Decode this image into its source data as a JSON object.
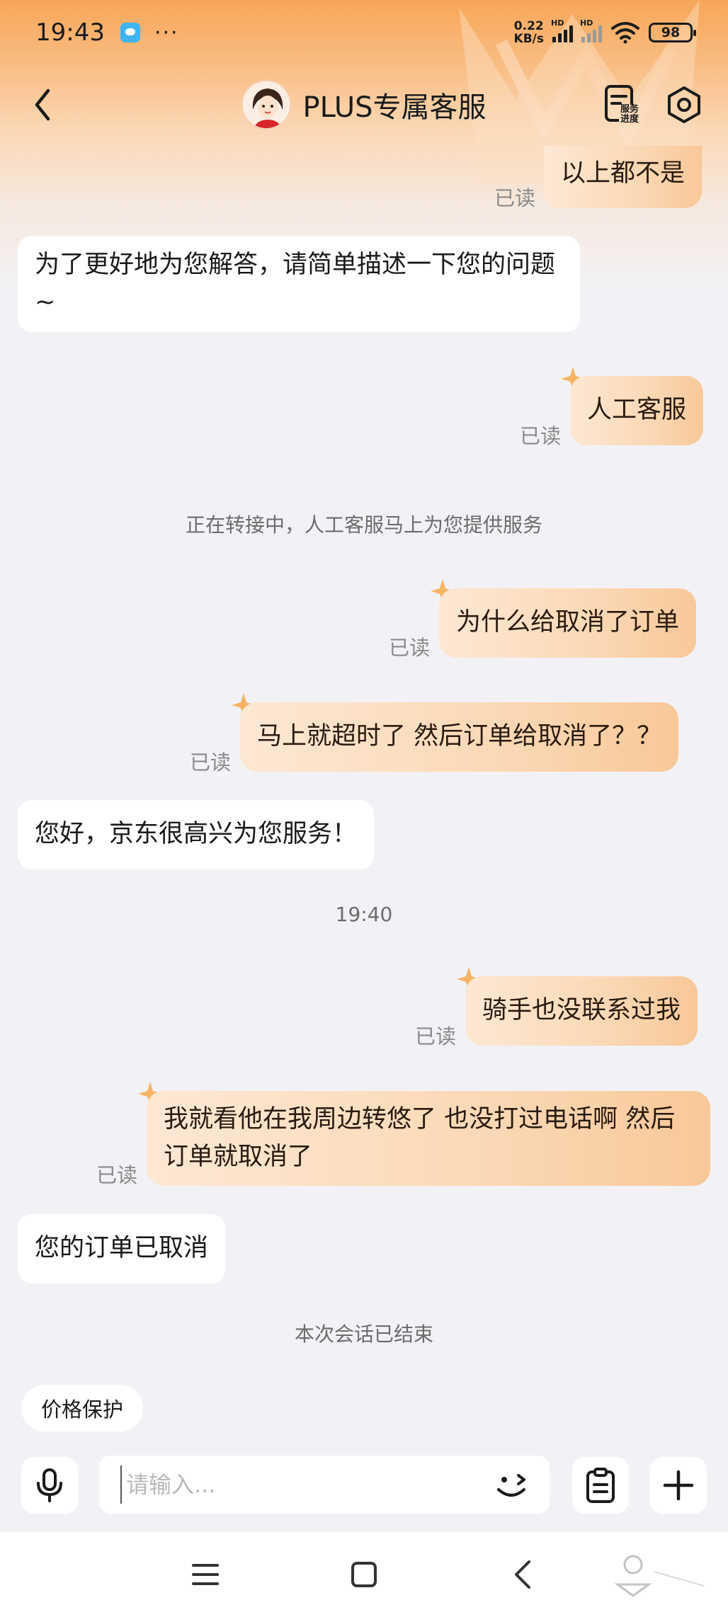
{
  "status_bar": {
    "time": "19:43",
    "more": "···",
    "net_speed_value": "0.22",
    "net_speed_unit": "KB/s",
    "hd1": "HD",
    "hd2": "HD",
    "battery": "98",
    "icons": [
      "notification-app-icon",
      "signal-icon",
      "wifi-icon",
      "battery-icon"
    ]
  },
  "header": {
    "title": "PLUS专属客服",
    "service_progress_label": "服务进度",
    "icons": [
      "back-icon",
      "agent-avatar",
      "service-progress-icon",
      "settings-icon"
    ]
  },
  "messages": [
    {
      "side": "right",
      "text": "以上都不是",
      "read": "已读"
    },
    {
      "side": "left",
      "text": "为了更好地为您解答，请简单描述一下您的问题~"
    },
    {
      "side": "right",
      "text": "人工客服",
      "read": "已读"
    },
    {
      "side": "system",
      "text": "正在转接中，人工客服马上为您提供服务"
    },
    {
      "side": "right",
      "text": "为什么给取消了订单",
      "read": "已读"
    },
    {
      "side": "right",
      "text": "马上就超时了  然后订单给取消了？？",
      "read": "已读"
    },
    {
      "side": "left",
      "text": "您好，京东很高兴为您服务！"
    },
    {
      "side": "system",
      "text": "19:40"
    },
    {
      "side": "right",
      "text": "骑手也没联系过我",
      "read": "已读"
    },
    {
      "side": "right",
      "text": "我就看他在我周边转悠了  也没打过电话啊 然后订单就取消了",
      "read": "已读"
    },
    {
      "side": "left",
      "text": "您的订单已取消"
    },
    {
      "side": "system",
      "text": "本次会话已结束"
    }
  ],
  "quick_reply": {
    "label": "价格保护"
  },
  "input": {
    "placeholder": "请输入..."
  },
  "bottom_icons": [
    "microphone-icon",
    "emoji-icon",
    "clipboard-icon",
    "plus-icon"
  ],
  "nav_icons": [
    "menu-icon",
    "home-icon",
    "back-nav-icon"
  ],
  "colors": {
    "accent": "#f7a658",
    "bubble_right": "#fbd8b5",
    "bubble_left": "#ffffff",
    "background": "#f2f2f6"
  }
}
